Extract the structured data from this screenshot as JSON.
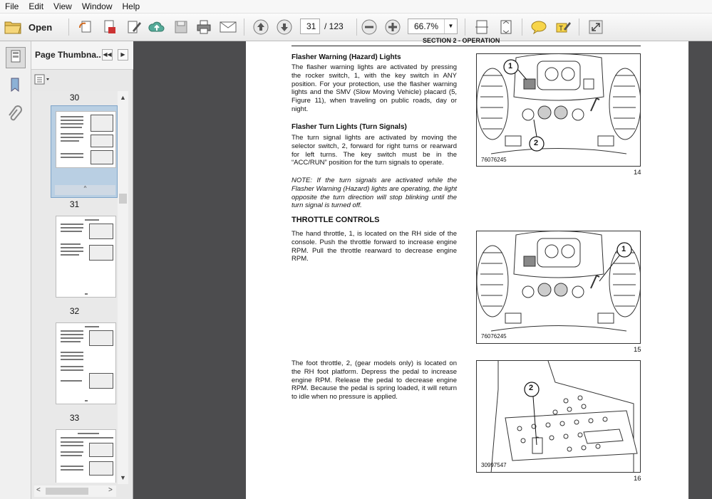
{
  "menu": [
    "File",
    "Edit",
    "View",
    "Window",
    "Help"
  ],
  "toolbar": {
    "open_label": "Open",
    "current_page": "31",
    "page_total": "/ 123",
    "zoom": "66.7%"
  },
  "sidebar": {
    "title": "Page Thumbna...",
    "thumbnails": [
      {
        "label": "30",
        "selected": false
      },
      {
        "label": "31",
        "selected": true
      },
      {
        "label": "32",
        "selected": false
      },
      {
        "label": "33",
        "selected": false
      }
    ]
  },
  "document": {
    "header_partial": "SECTION 2 - OPERATION",
    "sections": [
      {
        "heading": "Flasher Warning (Hazard) Lights",
        "body": "The flasher warning lights are activated by pressing the rocker switch, 1, with the key switch in ANY position. For your protection, use the flasher warning lights and the SMV (Slow Moving Vehicle) placard (5, Figure 11), when traveling on public roads, day or night."
      },
      {
        "heading": "Flasher Turn Lights (Turn Signals)",
        "body": "The turn signal lights are activated by moving the selector switch, 2, forward for right turns or rearward for left turns. The key switch must be in the “ACC/RUN” position for the turn signals to operate."
      },
      {
        "heading": "",
        "body": "NOTE: If the turn signals are activated while the Flasher Warning (Hazard) lights are operating, the light opposite the turn direction will stop blinking until the turn signal is turned off."
      },
      {
        "heading": "THROTTLE CONTROLS",
        "body": "The hand throttle, 1, is located on the RH side of the console. Push the throttle forward to increase engine RPM. Pull the throttle rearward to decrease engine RPM."
      },
      {
        "heading": "",
        "body": "The foot throttle, 2, (gear models only) is located on the RH foot platform. Depress the pedal to increase engine RPM. Release the pedal to decrease engine RPM. Because the pedal is spring loaded, it will return to idle when no pressure is applied."
      }
    ],
    "figures": [
      {
        "code": "76076245",
        "number": "14",
        "callouts": [
          "1",
          "2"
        ]
      },
      {
        "code": "76076245",
        "number": "15",
        "callouts": [
          "1"
        ]
      },
      {
        "code": "30997547",
        "number": "16",
        "callouts": [
          "2"
        ]
      }
    ]
  }
}
